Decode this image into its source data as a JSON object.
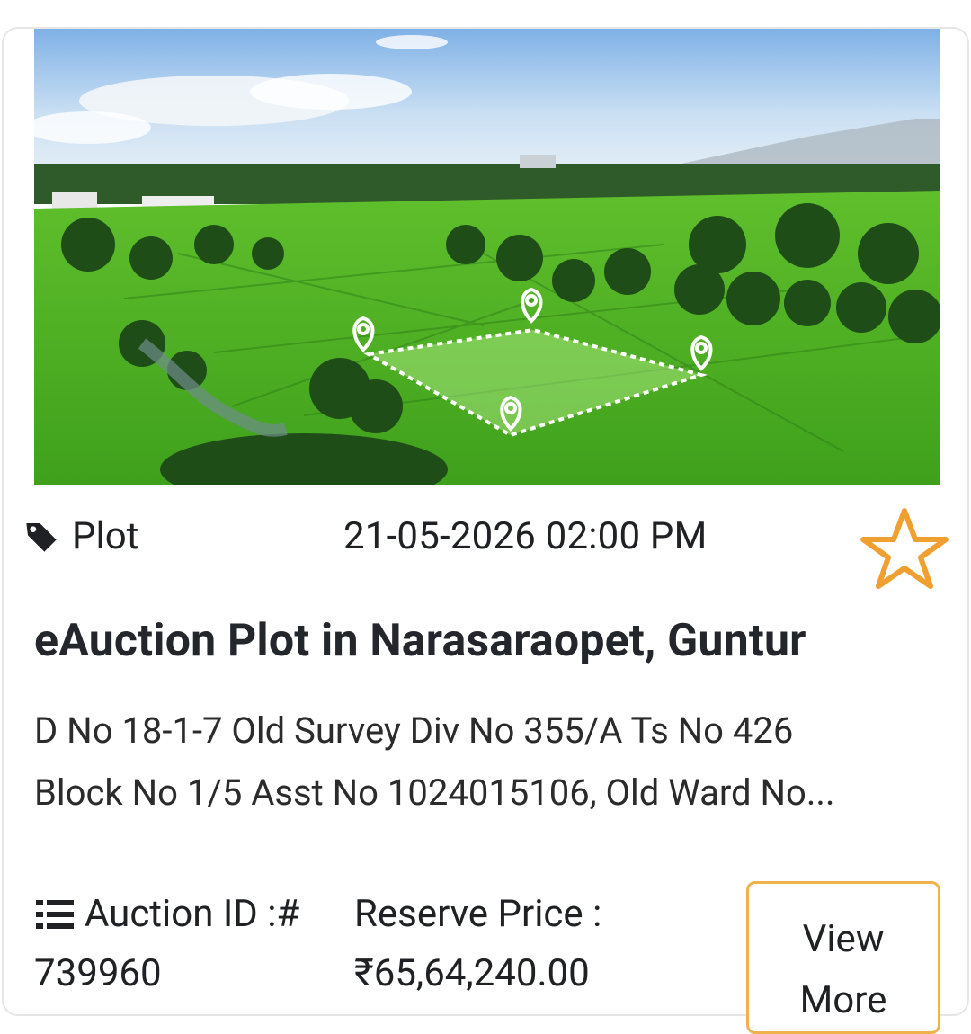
{
  "listing": {
    "category": "Plot",
    "auction_datetime": "21-05-2026 02:00 PM",
    "title": "eAuction Plot in Narasaraopet, Guntur",
    "description_line1": "D No 18-1-7 Old Survey Div No 355/A Ts No 426",
    "description_line2": "Block No 1/5 Asst No 1024015106, Old Ward No...",
    "auction_id_label": "Auction ID :#",
    "auction_id": "739960",
    "reserve_price_label": "Reserve Price :",
    "reserve_price": "₹65,64,240.00",
    "view_more_line1": "View",
    "view_more_line2": "More"
  },
  "icons": {
    "category": "tag-icon",
    "favorite": "star-outline-icon",
    "auction_id": "list-icon"
  },
  "colors": {
    "accent": "#f0a030",
    "button_border": "#f0b24b",
    "text": "#202124"
  }
}
